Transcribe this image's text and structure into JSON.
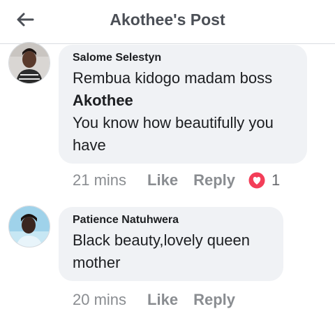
{
  "header": {
    "title": "Akothee's Post",
    "back_icon": "back-arrow-icon"
  },
  "comments": [
    {
      "author": "Salome Selestyn",
      "text_line1": "Rembua kidogo madam boss",
      "mention": "Akothee",
      "text_line2": "You know how beautifully you",
      "text_line3": "have",
      "time": "21 mins",
      "like_label": "Like",
      "reply_label": "Reply",
      "reaction_icon": "love-reaction-icon",
      "reaction_count": "1"
    },
    {
      "author": "Patience Natuhwera",
      "text_line1": "Black beauty,lovely queen",
      "text_line2": "mother",
      "time": "20 mins",
      "like_label": "Like",
      "reply_label": "Reply"
    }
  ],
  "colors": {
    "bubble": "#f0f2f5",
    "love": "#f33e58",
    "meta": "#8a8d91"
  }
}
